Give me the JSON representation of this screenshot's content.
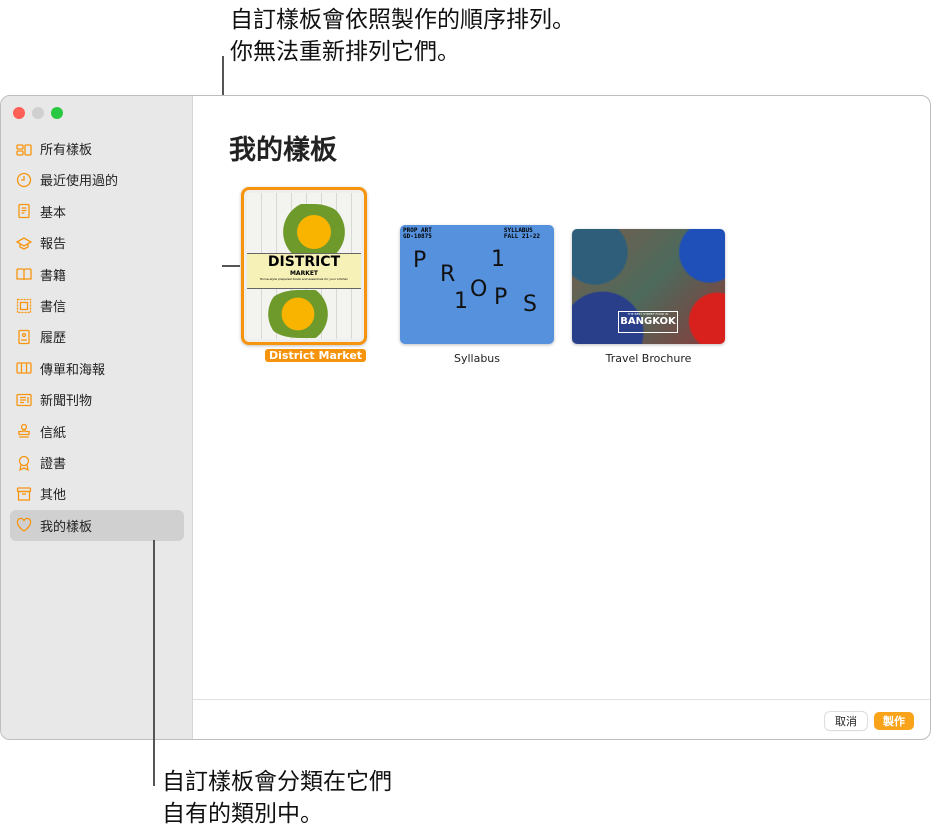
{
  "callouts": {
    "top": [
      "自訂樣板會依照製作的順序排列。",
      "你無法重新排列它們。"
    ],
    "bottom": [
      "自訂樣板會分類在它們",
      "自有的類別中。"
    ]
  },
  "sidebar": {
    "items": [
      {
        "label": "所有樣板",
        "icon": "grid-icon"
      },
      {
        "label": "最近使用過的",
        "icon": "clock-icon"
      },
      {
        "label": "基本",
        "icon": "document-icon"
      },
      {
        "label": "報告",
        "icon": "graduation-cap-icon"
      },
      {
        "label": "書籍",
        "icon": "book-icon"
      },
      {
        "label": "書信",
        "icon": "letter-icon"
      },
      {
        "label": "履歷",
        "icon": "resume-icon"
      },
      {
        "label": "傳單和海報",
        "icon": "flyer-icon"
      },
      {
        "label": "新聞刊物",
        "icon": "newsletter-icon"
      },
      {
        "label": "信紙",
        "icon": "stamp-icon"
      },
      {
        "label": "證書",
        "icon": "ribbon-icon"
      },
      {
        "label": "其他",
        "icon": "box-icon"
      },
      {
        "label": "我的樣板",
        "icon": "heart-icon"
      }
    ],
    "selected": 12
  },
  "main": {
    "title": "我的樣板",
    "templates": [
      {
        "name": "District Market",
        "cover_title": "DISTRICT",
        "cover_sub": "MARKET",
        "cover_tag": "Home-style prepared foods and essentials for your kitchen"
      },
      {
        "name": "Syllabus",
        "tl": [
          "PROP ART",
          "GD-10875"
        ],
        "tr": [
          "SYLLABUS",
          "FALL 21-22"
        ],
        "letters": [
          "P",
          "R",
          "O",
          "1",
          "1",
          "P",
          "S"
        ]
      },
      {
        "name": "Travel Brochure",
        "cover_small": "THE BEST STREET FOOD IN",
        "cover_title": "BANGKOK"
      }
    ]
  },
  "footer": {
    "cancel": "取消",
    "create": "製作"
  },
  "colors": {
    "accent": "#f7940e",
    "syllabus": "#5591dc"
  }
}
